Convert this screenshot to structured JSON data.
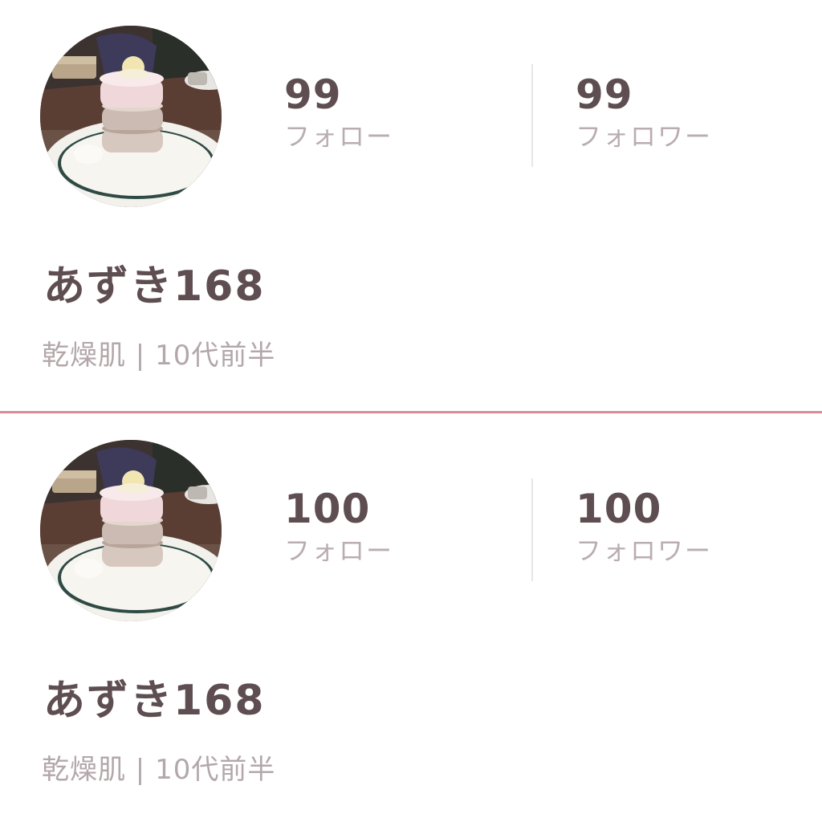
{
  "profiles": [
    {
      "avatar_icon": "pancake-stack-photo",
      "follow_count": "99",
      "follow_label": "フォロー",
      "follower_count": "99",
      "follower_label": "フォロワー",
      "username": "あずき168",
      "profile_meta": "乾燥肌 | 10代前半"
    },
    {
      "avatar_icon": "pancake-stack-photo",
      "follow_count": "100",
      "follow_label": "フォロー",
      "follower_count": "100",
      "follower_label": "フォロワー",
      "username": "あずき168",
      "profile_meta": "乾燥肌 | 10代前半"
    }
  ],
  "colors": {
    "divider": "#d98a92",
    "primary_text": "#5e4e51",
    "secondary_text": "#b9adb0"
  }
}
